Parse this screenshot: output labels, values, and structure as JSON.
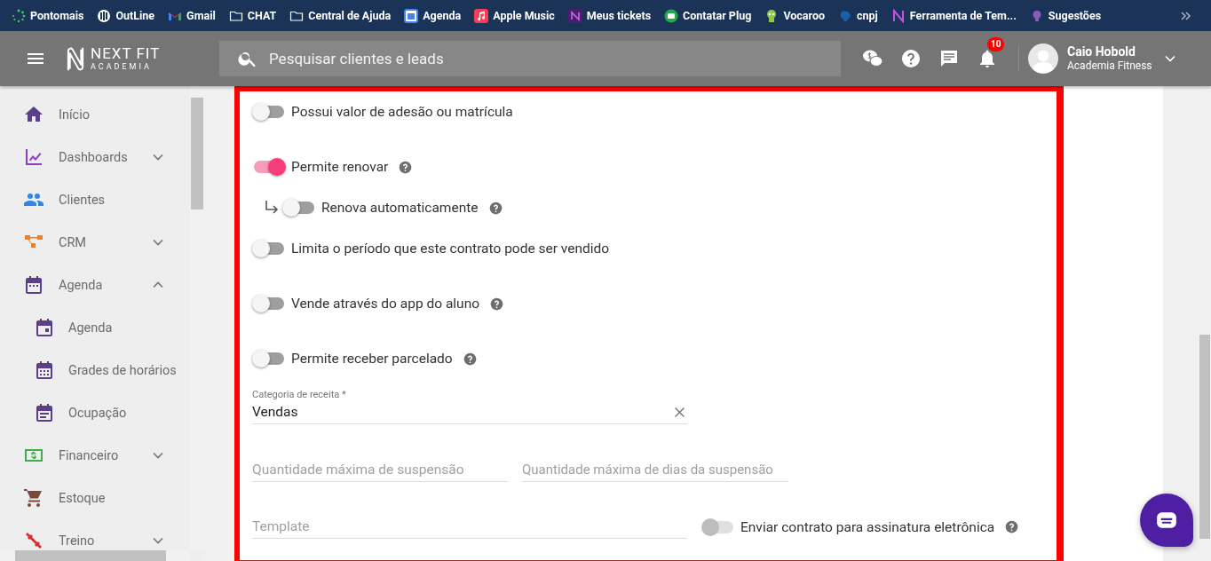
{
  "bookmarks": [
    {
      "label": "Pontomais"
    },
    {
      "label": "OutLine"
    },
    {
      "label": "Gmail"
    },
    {
      "label": "CHAT"
    },
    {
      "label": "Central de Ajuda"
    },
    {
      "label": "Agenda"
    },
    {
      "label": "Apple Music"
    },
    {
      "label": "Meus tickets"
    },
    {
      "label": "Contatar Plug"
    },
    {
      "label": "Vocaroo"
    },
    {
      "label": "cnpj"
    },
    {
      "label": "Ferramenta de Tem..."
    },
    {
      "label": "Sugestões"
    }
  ],
  "header": {
    "logo_main": "NEXT FIT",
    "logo_sub": "ACADEMIA",
    "search": {
      "placeholder": "Pesquisar clientes e leads"
    },
    "notification_count": "10",
    "user": {
      "name": "Caio Hobold",
      "org": "Academia Fitness"
    }
  },
  "sidebar": {
    "items": [
      {
        "label": "Início",
        "color": "#5b3f8c"
      },
      {
        "label": "Dashboards",
        "color": "#8e3fc1",
        "expanded": false
      },
      {
        "label": "Clientes",
        "color": "#2f86e8"
      },
      {
        "label": "CRM",
        "color": "#f57c1f",
        "expanded": false
      },
      {
        "label": "Agenda",
        "color": "#5b3f8c",
        "expanded": true,
        "children": [
          {
            "label": "Agenda",
            "color": "#5b3f8c"
          },
          {
            "label": "Grades de horários",
            "color": "#5b3f8c"
          },
          {
            "label": "Ocupação",
            "color": "#5b3f8c"
          }
        ]
      },
      {
        "label": "Financeiro",
        "color": "#3fae4a",
        "expanded": false
      },
      {
        "label": "Estoque",
        "color": "#7a4b3a"
      },
      {
        "label": "Treino",
        "color": "#d9302c",
        "expanded": false
      }
    ]
  },
  "form": {
    "toggles": [
      {
        "kind": "main",
        "label": "Possui valor de adesão ou matrícula",
        "on": false,
        "help": false
      },
      {
        "kind": "main",
        "label": "Permite renovar",
        "on": true,
        "help": true
      },
      {
        "kind": "sub",
        "label": "Renova automaticamente",
        "on": false,
        "help": true
      },
      {
        "kind": "main",
        "label": "Limita o período que este contrato pode ser vendido",
        "on": false,
        "help": false
      },
      {
        "kind": "main",
        "label": "Vende através do app do aluno",
        "on": false,
        "help": true
      },
      {
        "kind": "main",
        "label": "Permite receber parcelado",
        "on": false,
        "help": true
      }
    ],
    "category": {
      "label": "Categoria de receita *",
      "value": "Vendas"
    },
    "suspension_fields": [
      {
        "placeholder": "Quantidade máxima de suspensão"
      },
      {
        "placeholder": "Quantidade máxima de dias da suspensão"
      }
    ],
    "template": {
      "placeholder": "Template"
    },
    "signature": {
      "label": "Enviar contrato para assinatura eletrônica",
      "on": false,
      "disabled": true
    }
  }
}
